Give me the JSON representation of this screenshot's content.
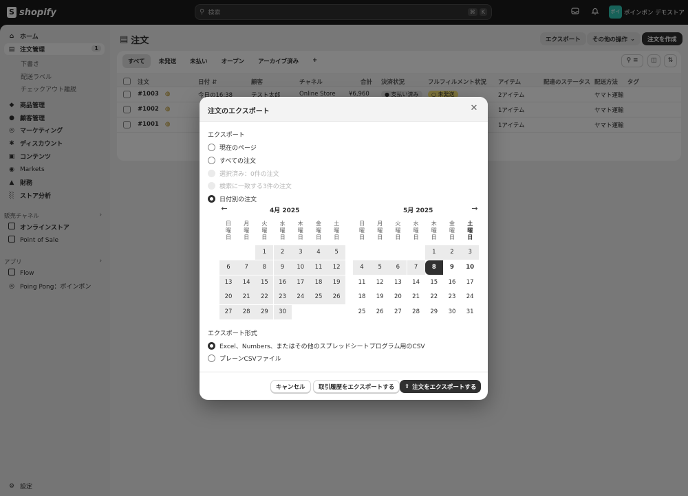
{
  "topbar": {
    "brand": "shopify",
    "search_placeholder": "検索",
    "shortcut_keys": [
      "⌘",
      "K"
    ],
    "store_avatar_text": "ポイ",
    "store_name": "ポインポン デモストア",
    "icons": [
      "search-icon",
      "inbox-icon",
      "bell-icon"
    ]
  },
  "sidebar": {
    "items": [
      {
        "label": "ホーム",
        "icon": "home-icon"
      },
      {
        "label": "注文管理",
        "icon": "orders-icon",
        "count": "1"
      },
      {
        "label": "下書き"
      },
      {
        "label": "配送ラベル"
      },
      {
        "label": "チェックアウト離脱"
      },
      {
        "label": "商品管理",
        "icon": "tag-icon"
      },
      {
        "label": "顧客管理",
        "icon": "person-icon"
      },
      {
        "label": "マーケティング",
        "icon": "target-icon"
      },
      {
        "label": "ディスカウント",
        "icon": "discount-icon"
      },
      {
        "label": "コンテンツ",
        "icon": "content-icon"
      },
      {
        "label": "Markets",
        "icon": "globe-icon"
      },
      {
        "label": "財務",
        "icon": "bank-icon"
      },
      {
        "label": "ストア分析",
        "icon": "chart-icon"
      }
    ],
    "sales_channels_label": "販売チャネル",
    "channels": [
      {
        "label": "オンラインストア"
      },
      {
        "label": "Point of Sale"
      }
    ],
    "apps_label": "アプリ",
    "apps": [
      {
        "label": "Flow"
      },
      {
        "label": "Poing Pong：ポインポン"
      }
    ],
    "settings_label": "設定"
  },
  "main": {
    "title": "注文",
    "buttons": {
      "export": "エクスポート",
      "more": "その他の操作",
      "create": "注文を作成"
    },
    "tabs": [
      "すべて",
      "未発送",
      "未払い",
      "オープン",
      "アーカイブ済み",
      "+"
    ],
    "columns": [
      "注文",
      "日付",
      "顧客",
      "チャネル",
      "合計",
      "決済状況",
      "フルフィルメント状況",
      "アイテム",
      "配達のステータス",
      "配送方法",
      "タグ"
    ],
    "rows": [
      {
        "order": "#1003",
        "date": "今日の16:38",
        "customer": "テスト太郎",
        "channel": "Online Store",
        "total": "¥6,960",
        "payment": "支払い済み",
        "fulfillment": "未発送",
        "items": "2アイテム",
        "shipping": "ヤマト運輸"
      },
      {
        "order": "#1002",
        "items": "1アイテム",
        "shipping": "ヤマト運輸"
      },
      {
        "order": "#1001",
        "items": "1アイテム",
        "shipping": "ヤマト運輸"
      }
    ]
  },
  "modal": {
    "title": "注文のエクスポート",
    "export_label": "エクスポート",
    "export_options": [
      {
        "label": "現在のページ",
        "state": "normal"
      },
      {
        "label": "すべての注文",
        "state": "normal"
      },
      {
        "label": "選択済み：0件の注文",
        "state": "disabled"
      },
      {
        "label": "検索に一致する3件の注文",
        "state": "disabled"
      },
      {
        "label": "日付別の注文",
        "state": "selected"
      }
    ],
    "calendar": {
      "prev_icon": "arrow-left-icon",
      "next_icon": "arrow-right-icon",
      "weekdays": [
        "日\n曜\n日",
        "月\n曜\n日",
        "火\n曜\n日",
        "水\n曜\n日",
        "木\n曜\n日",
        "金\n曜\n日",
        "土\n曜\n日"
      ],
      "months": [
        {
          "title": "4月 2025",
          "first_weekday": 2,
          "days": 30,
          "range_from": 1,
          "range_to": 30,
          "selected": null
        },
        {
          "title": "5月 2025",
          "first_weekday": 4,
          "days": 31,
          "range_from": 1,
          "range_to": 7,
          "selected": 8
        }
      ]
    },
    "format_label": "エクスポート形式",
    "format_options": [
      {
        "label": "Excel、Numbers、またはその他のスプレッドシートプログラム用のCSV",
        "state": "selected"
      },
      {
        "label": "プレーンCSVファイル",
        "state": "normal"
      }
    ],
    "buttons": {
      "cancel": "キャンセル",
      "export_transactions": "取引履歴をエクスポートする",
      "export_orders": "注文をエクスポートする"
    }
  }
}
